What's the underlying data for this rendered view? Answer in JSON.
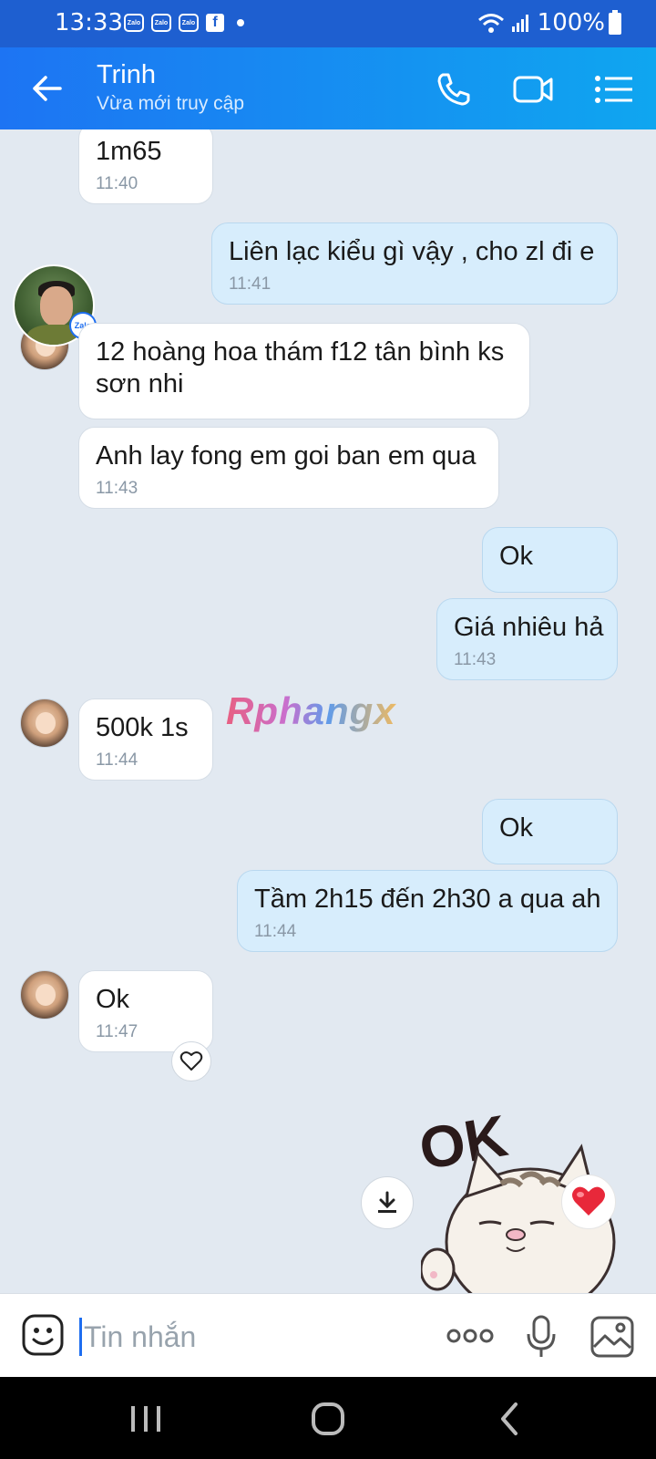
{
  "status_bar": {
    "time": "13:33",
    "notifications": [
      "Zalo",
      "Zalo",
      "Zalo"
    ],
    "facebook_icon": "f",
    "battery": "100%"
  },
  "header": {
    "contact_name": "Trinh",
    "contact_status": "Vừa mới truy cập",
    "icons": [
      "back-arrow-icon",
      "phone-icon",
      "video-call-icon",
      "list-menu-icon"
    ],
    "accent_color": "#1d74f3"
  },
  "messages": [
    {
      "dir": "in",
      "text": "1m65",
      "time": "11:40"
    },
    {
      "dir": "out",
      "text": "Liên lạc kiểu gì vậy , cho zl đi e",
      "time": "11:41"
    },
    {
      "dir": "in",
      "text": "12 hoàng hoa thám f12 tân bình ks",
      "text2": "sơn nhi"
    },
    {
      "dir": "in",
      "text": "Anh lay fong em goi ban em qua",
      "time": "11:43"
    },
    {
      "dir": "out",
      "text": "Ok"
    },
    {
      "dir": "out",
      "text": "Giá nhiêu hả",
      "time": "11:43"
    },
    {
      "dir": "in",
      "text": "500k 1s",
      "time": "11:44"
    },
    {
      "dir": "out",
      "text": "Ok"
    },
    {
      "dir": "out",
      "text": "Tầm 2h15 đến 2h30 a qua ah",
      "time": "11:44"
    },
    {
      "dir": "in",
      "text": "Ok",
      "time": "11:47"
    }
  ],
  "watermark": "Rphangx",
  "avatar_badge": "Zalo",
  "sticker_text": "OK",
  "input": {
    "placeholder": "Tin nhắn"
  },
  "colors": {
    "chat_background": "#e2e9f1",
    "outgoing_bubble": "#d7edfc",
    "incoming_bubble": "#ffffff",
    "header_gradient_end": "#0fa6f0"
  }
}
